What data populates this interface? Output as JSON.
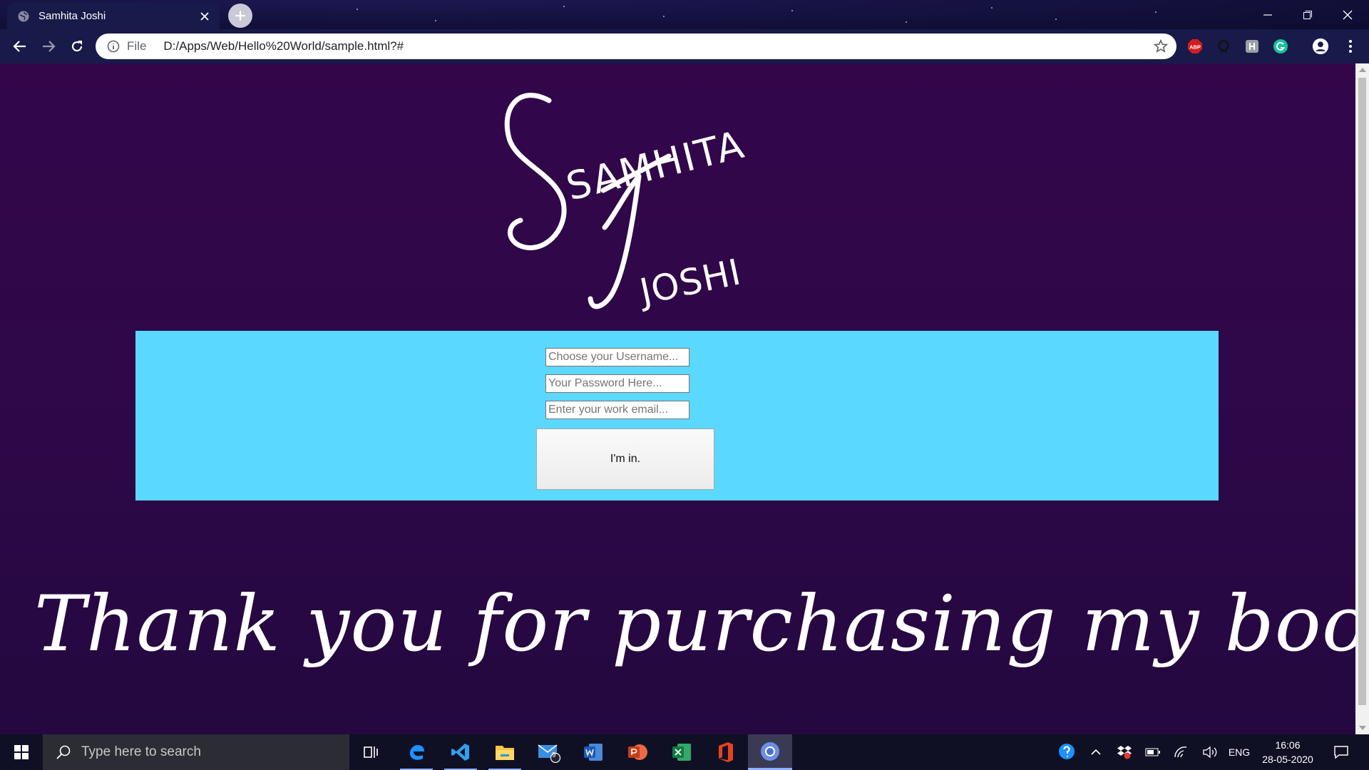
{
  "browser": {
    "tab_title": "Samhita Joshi",
    "url_scheme": "File",
    "url": "D:/Apps/Web/Hello%20World/sample.html?#",
    "extensions": [
      "abp-icon",
      "octocat-icon",
      "extension-icon",
      "grammarly-icon"
    ],
    "abp_label": "ABP"
  },
  "page": {
    "logo_line1": "SAMHITA",
    "logo_line2": "JOSHI",
    "form": {
      "username_placeholder": "Choose your Username...",
      "password_placeholder": "Your Password Here...",
      "email_placeholder": "Enter your work email...",
      "submit_label": "I'm in."
    },
    "thanks_text": "Thank you for purchasing my book. Your book is"
  },
  "taskbar": {
    "search_placeholder": "Type here to search",
    "mail_badge": "9",
    "language": "ENG",
    "time": "16:06",
    "date": "28-05-2020"
  },
  "colors": {
    "page_bg": "#2d0848",
    "form_bg": "#5bd8fd",
    "chrome_bg": "#181a4a"
  }
}
